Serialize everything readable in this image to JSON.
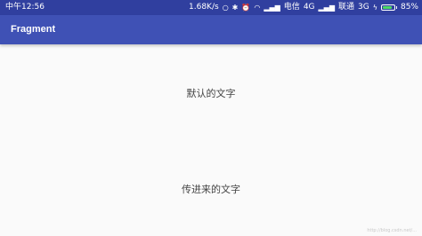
{
  "status_bar": {
    "time": "中午12:56",
    "net_speed": "1.68K/s",
    "carrier1": "电信",
    "carrier1_net": "4G",
    "carrier2": "联通",
    "carrier2_net": "3G",
    "battery_percent_text": "85%",
    "battery_level": 0.85
  },
  "app_bar": {
    "title": "Fragment"
  },
  "content": {
    "default_text": "默认的文字",
    "passed_text": "传进来的文字"
  },
  "watermark": "http://blog.csdn.net/..."
}
